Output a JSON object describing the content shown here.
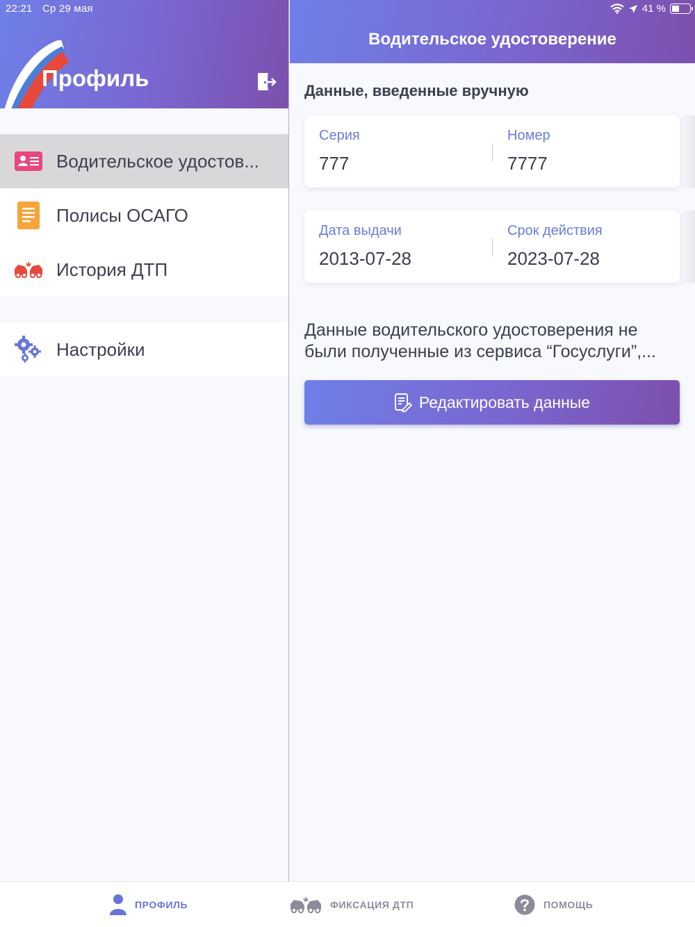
{
  "status_bar": {
    "time": "22:21",
    "date": "Ср 29 мая",
    "battery_percent": "41 %",
    "battery_level": 0.41
  },
  "sidebar": {
    "title": "Профиль",
    "logout_icon": "logout-icon",
    "items": [
      {
        "label": "Водительское удостов...",
        "icon": "driver-license-icon",
        "active": true
      },
      {
        "label": "Полисы ОСАГО",
        "icon": "document-icon",
        "active": false
      },
      {
        "label": "История ДТП",
        "icon": "car-crash-icon",
        "active": false
      },
      {
        "label": "Настройки",
        "icon": "gears-icon",
        "active": false
      }
    ]
  },
  "main": {
    "title": "Водительское удостоверение",
    "section_title": "Данные, введенные вручную",
    "card1": {
      "left_label": "Серия",
      "left_value": "777",
      "right_label": "Номер",
      "right_value": "7777"
    },
    "card2": {
      "left_label": "Дата выдачи",
      "left_value": "2013-07-28",
      "right_label": "Срок действия",
      "right_value": "2023-07-28"
    },
    "info_text": "Данные водительского удостоверения не были полученные из сервиса “Госуслуги”,...",
    "edit_button": "Редактировать данные"
  },
  "tabbar": {
    "tabs": [
      {
        "label": "ПРОФИЛЬ",
        "icon": "person-icon",
        "active": true
      },
      {
        "label": "ФИКСАЦИЯ ДТП",
        "icon": "car-crash-icon",
        "active": false
      },
      {
        "label": "ПОМОЩЬ",
        "icon": "help-icon",
        "active": false
      }
    ]
  },
  "colors": {
    "accent": "#6b7be0",
    "header_gradient_start": "#6f7fe8",
    "header_gradient_end": "#7c50ad",
    "flag_red": "#e8483a",
    "license_icon": "#e8467c",
    "document_icon": "#f6a53a",
    "crash_icon": "#e8483a"
  }
}
